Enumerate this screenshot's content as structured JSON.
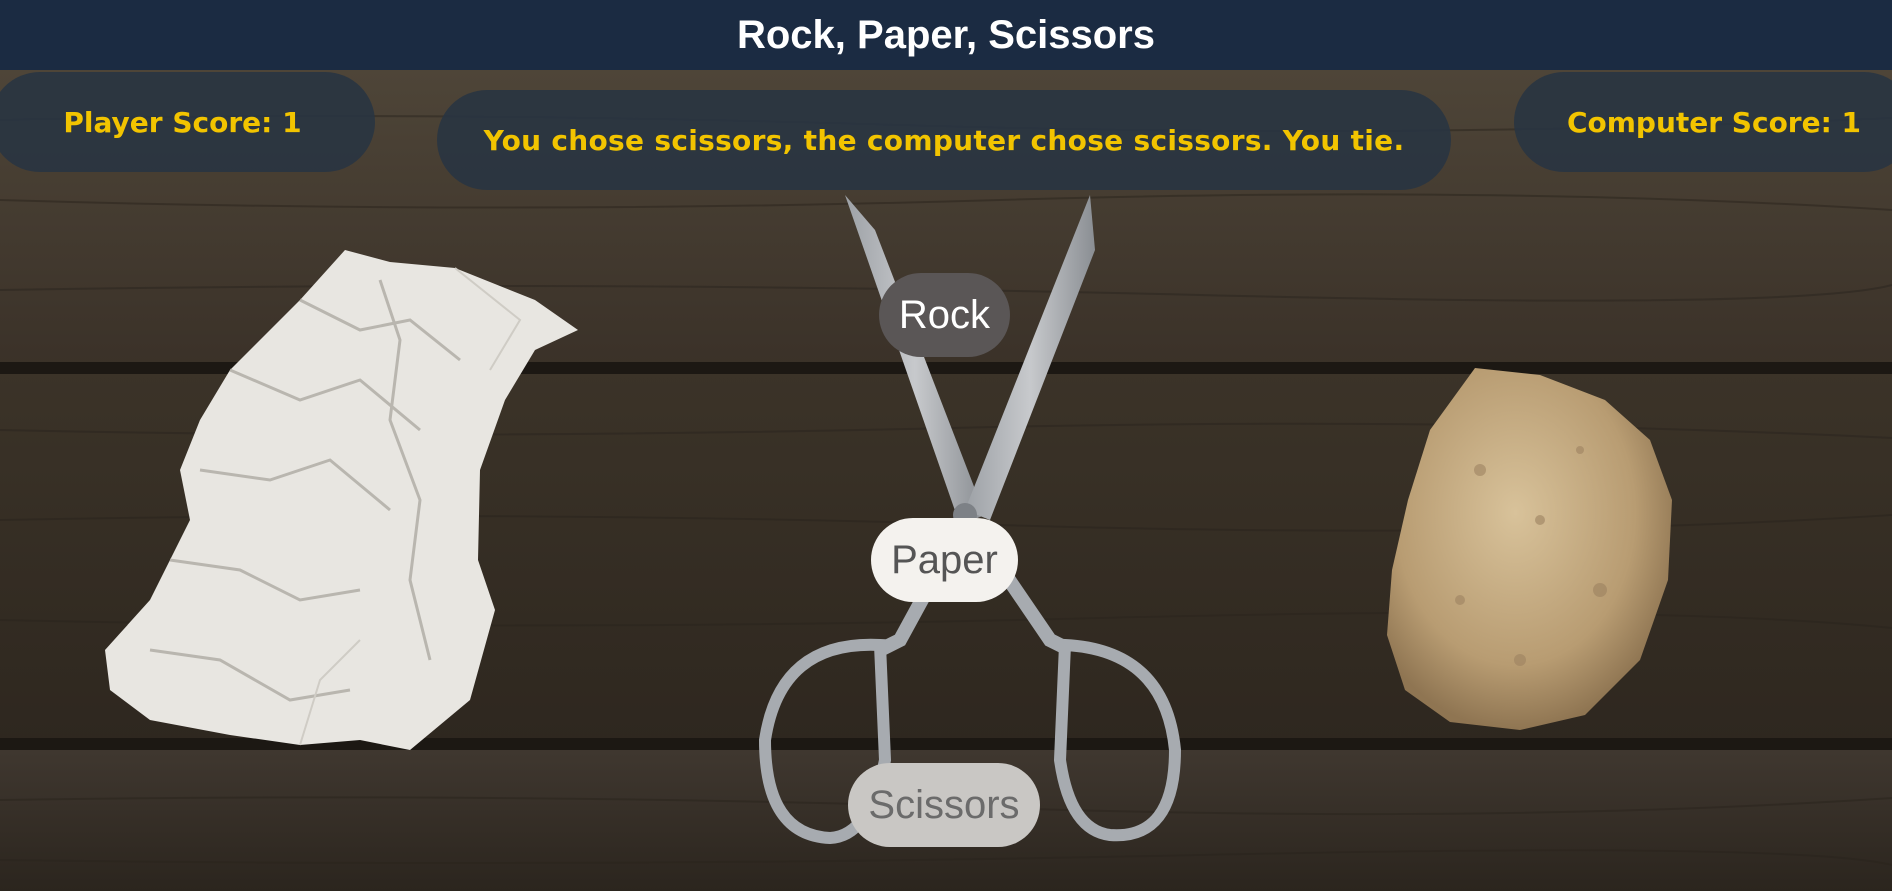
{
  "header": {
    "title": "Rock, Paper, Scissors"
  },
  "scores": {
    "player_label": "Player Score: 1",
    "computer_label": "Computer Score: 1"
  },
  "result": {
    "message": "You chose scissors, the computer chose scissors. You tie."
  },
  "choices": {
    "rock_label": "Rock",
    "paper_label": "Paper",
    "scissors_label": "Scissors"
  },
  "colors": {
    "header_bg": "#1b2b42",
    "score_text": "#f2c400",
    "pill_bg": "#283442"
  }
}
